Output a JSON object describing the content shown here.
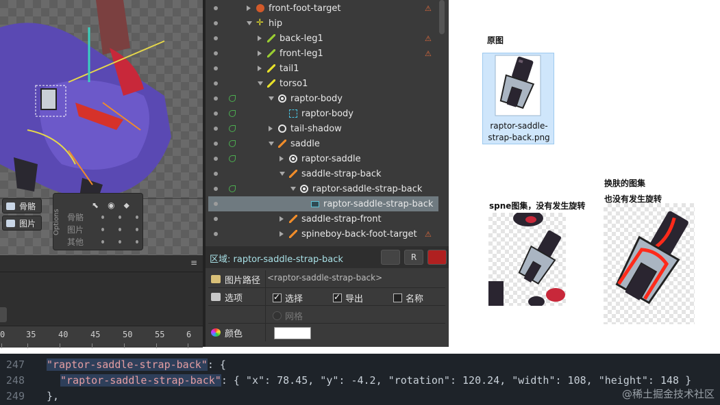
{
  "viewport": {
    "bone_button": "骨骼",
    "image_button": "图片",
    "options": {
      "title": "Options",
      "rows": [
        "骨骼",
        "图片",
        "其他"
      ]
    }
  },
  "timeline": {
    "ticks": [
      "0",
      "35",
      "40",
      "45",
      "50",
      "55",
      "6"
    ]
  },
  "tree": {
    "rows": [
      {
        "label": "front-foot-target",
        "icon": "target-icon",
        "warn": true
      },
      {
        "label": "hip",
        "icon": "hip-icon",
        "warn": false
      },
      {
        "label": "back-leg1",
        "icon": "bone-icon",
        "warn": true
      },
      {
        "label": "front-leg1",
        "icon": "bone-icon",
        "warn": true
      },
      {
        "label": "tail1",
        "icon": "bone-icon",
        "warn": false
      },
      {
        "label": "torso1",
        "icon": "bone-icon",
        "warn": false
      },
      {
        "label": "raptor-body",
        "icon": "slot-icon",
        "warn": false
      },
      {
        "label": "raptor-body",
        "icon": "mesh-icon",
        "warn": false
      },
      {
        "label": "tail-shadow",
        "icon": "slot-empty-icon",
        "warn": false
      },
      {
        "label": "saddle",
        "icon": "bone-icon",
        "warn": false
      },
      {
        "label": "raptor-saddle",
        "icon": "slot-icon",
        "warn": false
      },
      {
        "label": "saddle-strap-back",
        "icon": "bone-icon",
        "warn": false
      },
      {
        "label": "raptor-saddle-strap-back",
        "icon": "slot-icon",
        "warn": false
      },
      {
        "label": "raptor-saddle-strap-back",
        "icon": "region-icon",
        "warn": false
      },
      {
        "label": "saddle-strap-front",
        "icon": "bone-icon",
        "warn": false
      },
      {
        "label": "spineboy-back-foot-target",
        "icon": "bone-icon",
        "warn": true
      }
    ]
  },
  "region": {
    "title": "区域: raptor-saddle-strap-back",
    "path_label": "图片路径",
    "path_value": "<raptor-saddle-strap-back>",
    "options_label": "选项",
    "select_label": "选择",
    "export_label": "导出",
    "name_label": "名称",
    "grid_label": "网格",
    "color_label": "颜色",
    "color_value": "#ffffff"
  },
  "annotations": {
    "original_caption": "原图",
    "original_filename": "raptor-saddle-strap-back.png",
    "spine_caption": "spne图集，没有发生旋转",
    "skin_caption_1": "换肤的图集",
    "skin_caption_2": "也没有发生旋转"
  },
  "code": {
    "lines": [
      {
        "num": "247",
        "key": "\"raptor-saddle-strap-back\"",
        "rest": ": {"
      },
      {
        "num": "248",
        "key": "\"raptor-saddle-strap-back\"",
        "rest": ": { \"x\": 78.45, \"y\": -4.2, \"rotation\": 120.24, \"width\": 108, \"height\": 148 }"
      },
      {
        "num": "249",
        "key": "",
        "rest": "},"
      }
    ],
    "watermark": "@稀土掘金技术社区"
  }
}
